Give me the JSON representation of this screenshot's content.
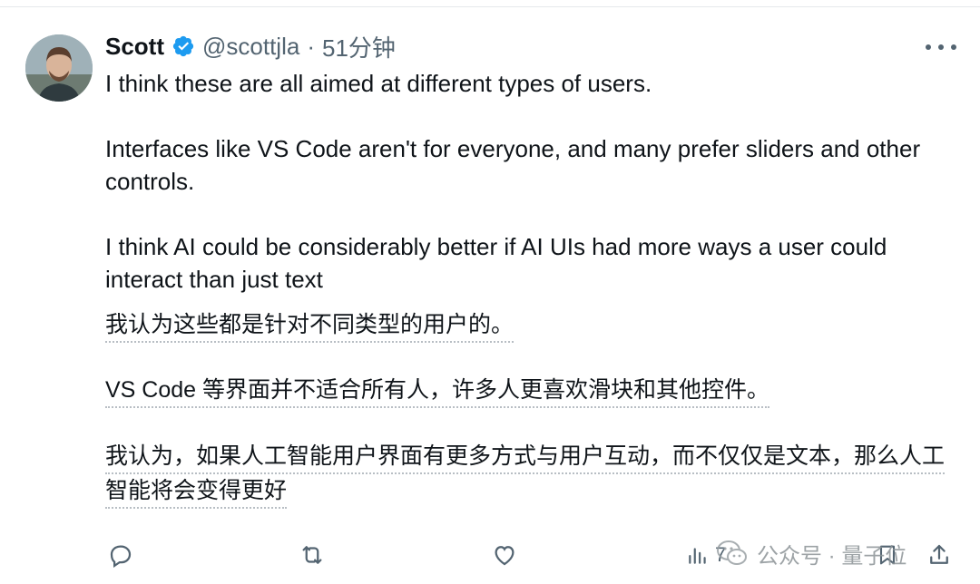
{
  "tweet": {
    "author": {
      "name": "Scott",
      "handle": "@scottjla",
      "separator": "·",
      "time": "51分钟",
      "verified": true
    },
    "english_paragraphs": [
      "I think these are all aimed at different types of users.",
      "Interfaces like VS Code aren't for everyone, and many prefer sliders and other controls.",
      "I think AI could be considerably better if AI UIs had more ways a user could interact than just text"
    ],
    "translation_paragraphs": [
      "我认为这些都是针对不同类型的用户的。",
      "VS Code 等界面并不适合所有人，许多人更喜欢滑块和其他控件。",
      "我认为，如果人工智能用户界面有更多方式与用户互动，而不仅仅是文本，那么人工智能将会变得更好"
    ],
    "actions": {
      "reply_icon": "reply-icon",
      "retweet_icon": "retweet-icon",
      "like_icon": "heart-icon",
      "views_icon": "views-icon",
      "views_count": "7",
      "bookmark_icon": "bookmark-icon",
      "share_icon": "share-icon"
    },
    "colors": {
      "verified": "#1d9bf0",
      "secondary_text": "#536471",
      "primary_text": "#0f1419"
    }
  },
  "watermark": {
    "text": "公众号 · 量子位"
  }
}
